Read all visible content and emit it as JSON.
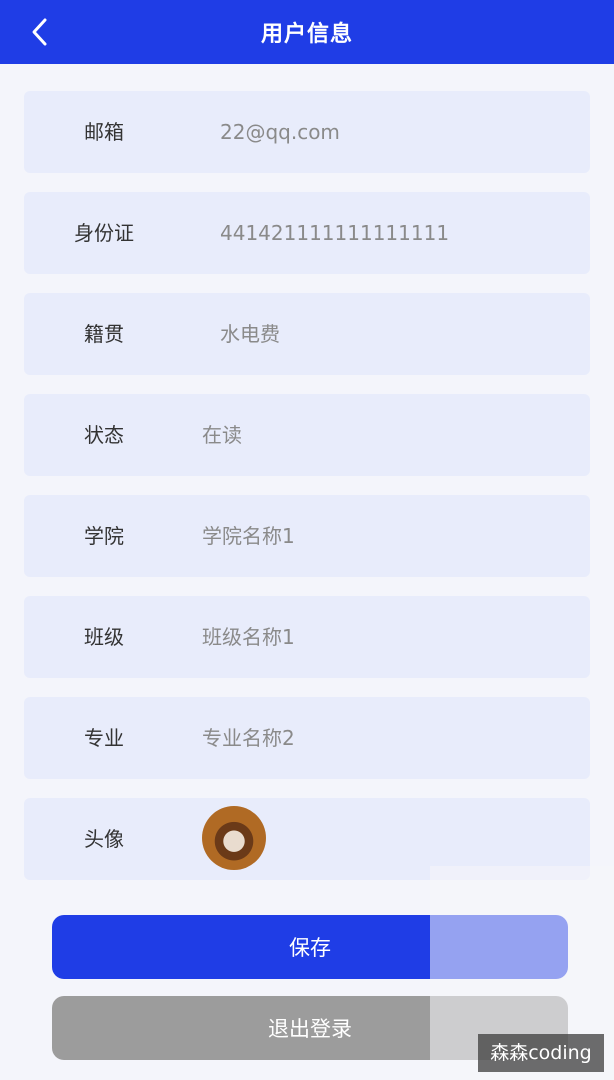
{
  "header": {
    "title": "用户信息",
    "back_icon": "chevron-left-icon"
  },
  "form": {
    "rows": [
      {
        "label": "邮箱",
        "value": "22@qq.com"
      },
      {
        "label": "身份证",
        "value": "441421111111111111"
      },
      {
        "label": "籍贯",
        "value": "水电费"
      },
      {
        "label": "状态",
        "value": "在读"
      },
      {
        "label": "学院",
        "value": "学院名称1"
      },
      {
        "label": "班级",
        "value": "班级名称1"
      },
      {
        "label": "专业",
        "value": "专业名称2"
      },
      {
        "label": "头像",
        "value": ""
      }
    ]
  },
  "buttons": {
    "save": "保存",
    "logout": "退出登录"
  },
  "watermark": "森森coding",
  "colors": {
    "primary": "#1f3de6",
    "row_bg": "#e8ecfb",
    "logout_bg": "#9c9c9c"
  }
}
